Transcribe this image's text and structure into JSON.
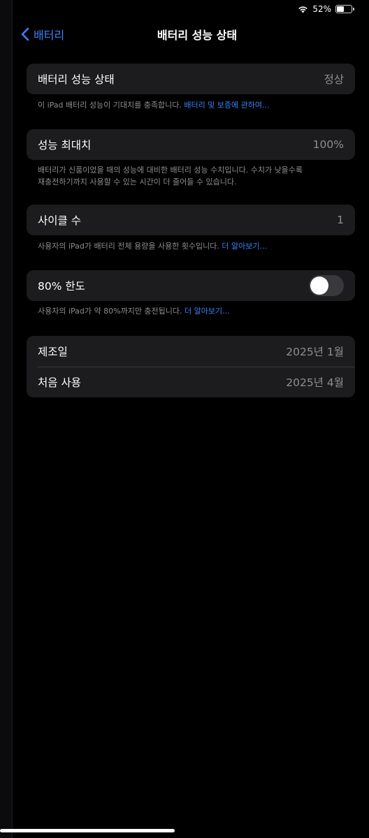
{
  "status_bar": {
    "battery_percent": "52%",
    "battery_level": 0.52
  },
  "nav": {
    "back_label": "배터리",
    "title": "배터리 성능 상태"
  },
  "health": {
    "label": "배터리 성능 상태",
    "value": "정상",
    "note": "이 iPad 배터리 성능이 기대치를 충족합니다. ",
    "note_link": "배터리 및 보증에 관하여..."
  },
  "max_capacity": {
    "label": "성능 최대치",
    "value": "100%",
    "note_line1": "배터리가 신품이었을 때의 성능에 대비한 배터리 성능 수치입니다. 수치가 낮을수록",
    "note_line2": "재충전하기까지 사용할 수 있는 시간이 더 줄어들 수 있습니다."
  },
  "cycle_count": {
    "label": "사이클 수",
    "value": "1",
    "note": "사용자의 iPad가 배터리 전체 용량을 사용한 횟수입니다. ",
    "note_link": "더 알아보기..."
  },
  "limit_80": {
    "label": "80% 한도",
    "enabled": false,
    "note": "사용자의 iPad가 약 80%까지만 충전됩니다. ",
    "note_link": "더 알아보기..."
  },
  "dates": {
    "manufactured_label": "제조일",
    "manufactured_value": "2025년 1월",
    "first_use_label": "처음 사용",
    "first_use_value": "2025년 4월"
  },
  "colors": {
    "background": "#000000",
    "cell": "#1c1c1e",
    "accent": "#3a82f7",
    "secondary_text": "#8e8e93",
    "toggle_off": "#39393d"
  }
}
